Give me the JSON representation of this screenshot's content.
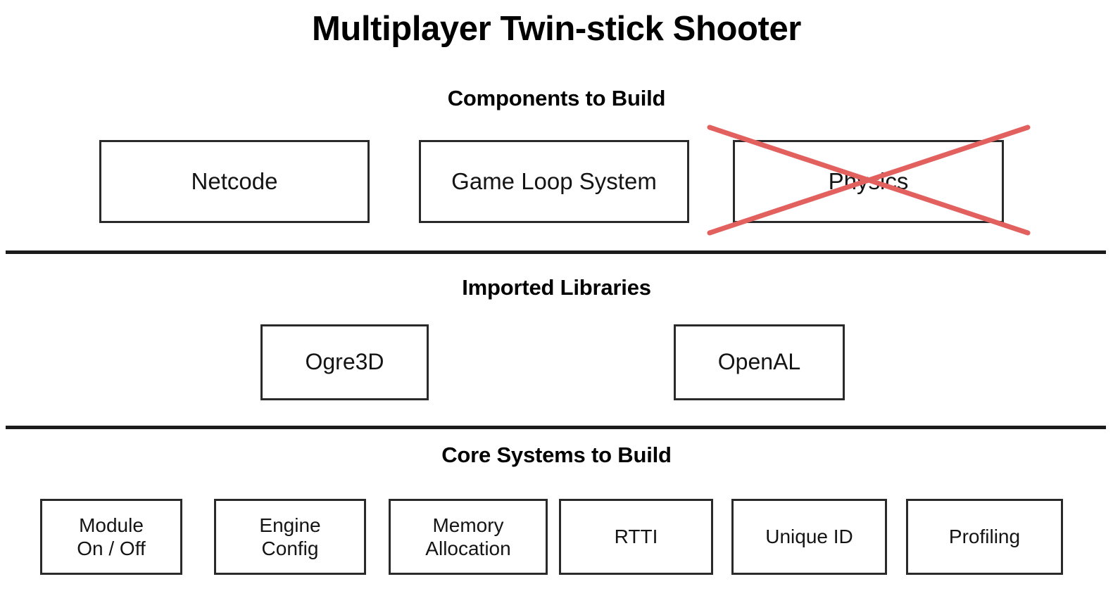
{
  "title": "Multiplayer Twin-stick Shooter",
  "theme": {
    "background": "#ffffff",
    "text": "#000000",
    "box_border": "#2a2a2a",
    "divider": "#1b1b1b",
    "strike_red": "#e2615e"
  },
  "sections": [
    {
      "id": "components",
      "heading": "Components to Build",
      "boxes": [
        {
          "label": "Netcode",
          "struck_out": false
        },
        {
          "label": "Game Loop System",
          "struck_out": false
        },
        {
          "label": "Physics",
          "struck_out": true
        }
      ]
    },
    {
      "id": "libraries",
      "heading": "Imported Libraries",
      "boxes": [
        {
          "label": "Ogre3D",
          "struck_out": false
        },
        {
          "label": "OpenAL",
          "struck_out": false
        }
      ]
    },
    {
      "id": "core",
      "heading": "Core Systems to Build",
      "boxes": [
        {
          "label": "Module\nOn / Off",
          "struck_out": false
        },
        {
          "label": "Engine\nConfig",
          "struck_out": false
        },
        {
          "label": "Memory\nAllocation",
          "struck_out": false
        },
        {
          "label": "RTTI",
          "struck_out": false
        },
        {
          "label": "Unique ID",
          "struck_out": false
        },
        {
          "label": "Profiling",
          "struck_out": false
        }
      ]
    }
  ]
}
